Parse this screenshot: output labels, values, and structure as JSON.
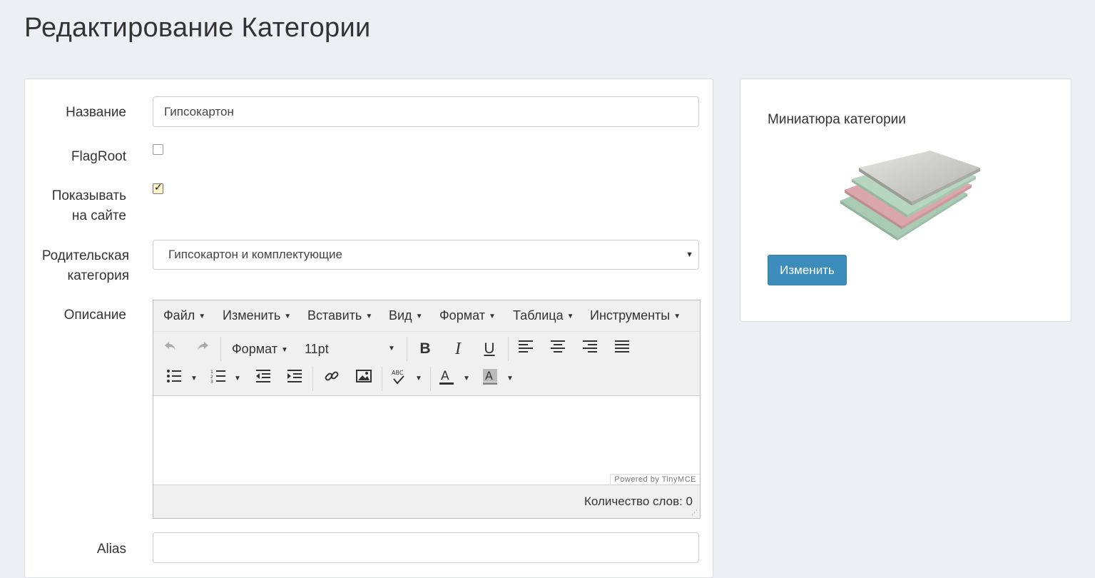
{
  "page": {
    "title": "Редактирование Категории"
  },
  "form": {
    "name_label": "Название",
    "name_value": "Гипсокартон",
    "flagroot_label": "FlagRoot",
    "flagroot_checked": false,
    "show_label_line1": "Показывать",
    "show_label_line2": "на сайте",
    "show_checked": true,
    "parent_label_line1": "Родительская",
    "parent_label_line2": "категория",
    "parent_value": "Гипсокартон и комплектующие",
    "description_label": "Описание",
    "alias_label": "Alias"
  },
  "editor": {
    "menu": [
      "Файл",
      "Изменить",
      "Вставить",
      "Вид",
      "Формат",
      "Таблица",
      "Инструменты"
    ],
    "format_dropdown": "Формат",
    "fontsize_dropdown": "11pt",
    "powered_by": "Powered by TinyMCE",
    "word_count": "Количество слов: 0",
    "icons": [
      "undo-icon",
      "redo-icon",
      "bold-icon",
      "italic-icon",
      "underline-icon",
      "align-left-icon",
      "align-center-icon",
      "align-right-icon",
      "align-justify-icon",
      "bullet-list-icon",
      "numbered-list-icon",
      "outdent-icon",
      "indent-icon",
      "link-icon",
      "image-icon",
      "spellcheck-icon",
      "text-color-icon",
      "background-color-icon"
    ]
  },
  "sidebar": {
    "title": "Миниатюра категории",
    "change_button": "Изменить"
  },
  "colors": {
    "background": "#ecf0f5",
    "primary": "#3c8dbc"
  }
}
